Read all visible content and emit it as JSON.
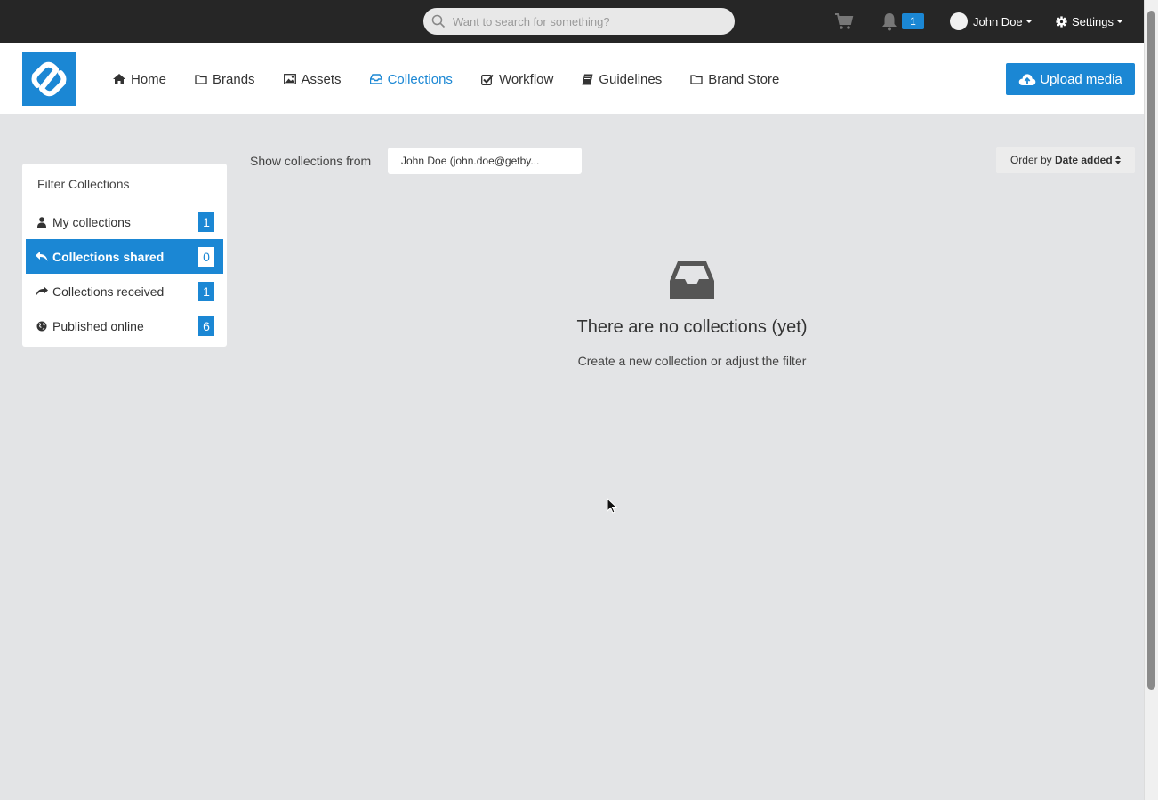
{
  "topbar": {
    "search": {
      "placeholder": "Want to search for something?",
      "icon": "search-icon"
    },
    "cart_icon": "cart-icon",
    "notifications": {
      "icon": "bell-icon",
      "count": "1"
    },
    "user": {
      "name": "John Doe"
    },
    "settings": {
      "label": "Settings",
      "icon": "gear-icon"
    }
  },
  "header": {
    "nav": [
      {
        "label": "Home",
        "icon": "home-icon"
      },
      {
        "label": "Brands",
        "icon": "folder-icon"
      },
      {
        "label": "Assets",
        "icon": "image-icon"
      },
      {
        "label": "Collections",
        "icon": "inbox-icon",
        "active": true
      },
      {
        "label": "Workflow",
        "icon": "check-square-icon"
      },
      {
        "label": "Guidelines",
        "icon": "book-icon"
      },
      {
        "label": "Brand Store",
        "icon": "folder-icon"
      }
    ],
    "upload_label": "Upload media"
  },
  "filter": {
    "title": "Filter Collections",
    "items": [
      {
        "label": "My collections",
        "count": "1",
        "icon": "user-icon"
      },
      {
        "label": "Collections shared",
        "count": "0",
        "icon": "reply-icon",
        "active": true
      },
      {
        "label": "Collections received",
        "count": "1",
        "icon": "share-icon"
      },
      {
        "label": "Published online",
        "count": "6",
        "icon": "globe-icon"
      }
    ]
  },
  "toolbar": {
    "show_label": "Show collections from",
    "show_value": "John Doe (john.doe@getby...",
    "order_prefix": "Order by",
    "order_value": "Date added"
  },
  "empty": {
    "icon": "inbox-icon",
    "title": "There are no collections (yet)",
    "subtitle": "Create a new collection or adjust the filter"
  },
  "colors": {
    "accent": "#1b87d4",
    "topbar": "#262626",
    "background": "#e3e4e6"
  }
}
